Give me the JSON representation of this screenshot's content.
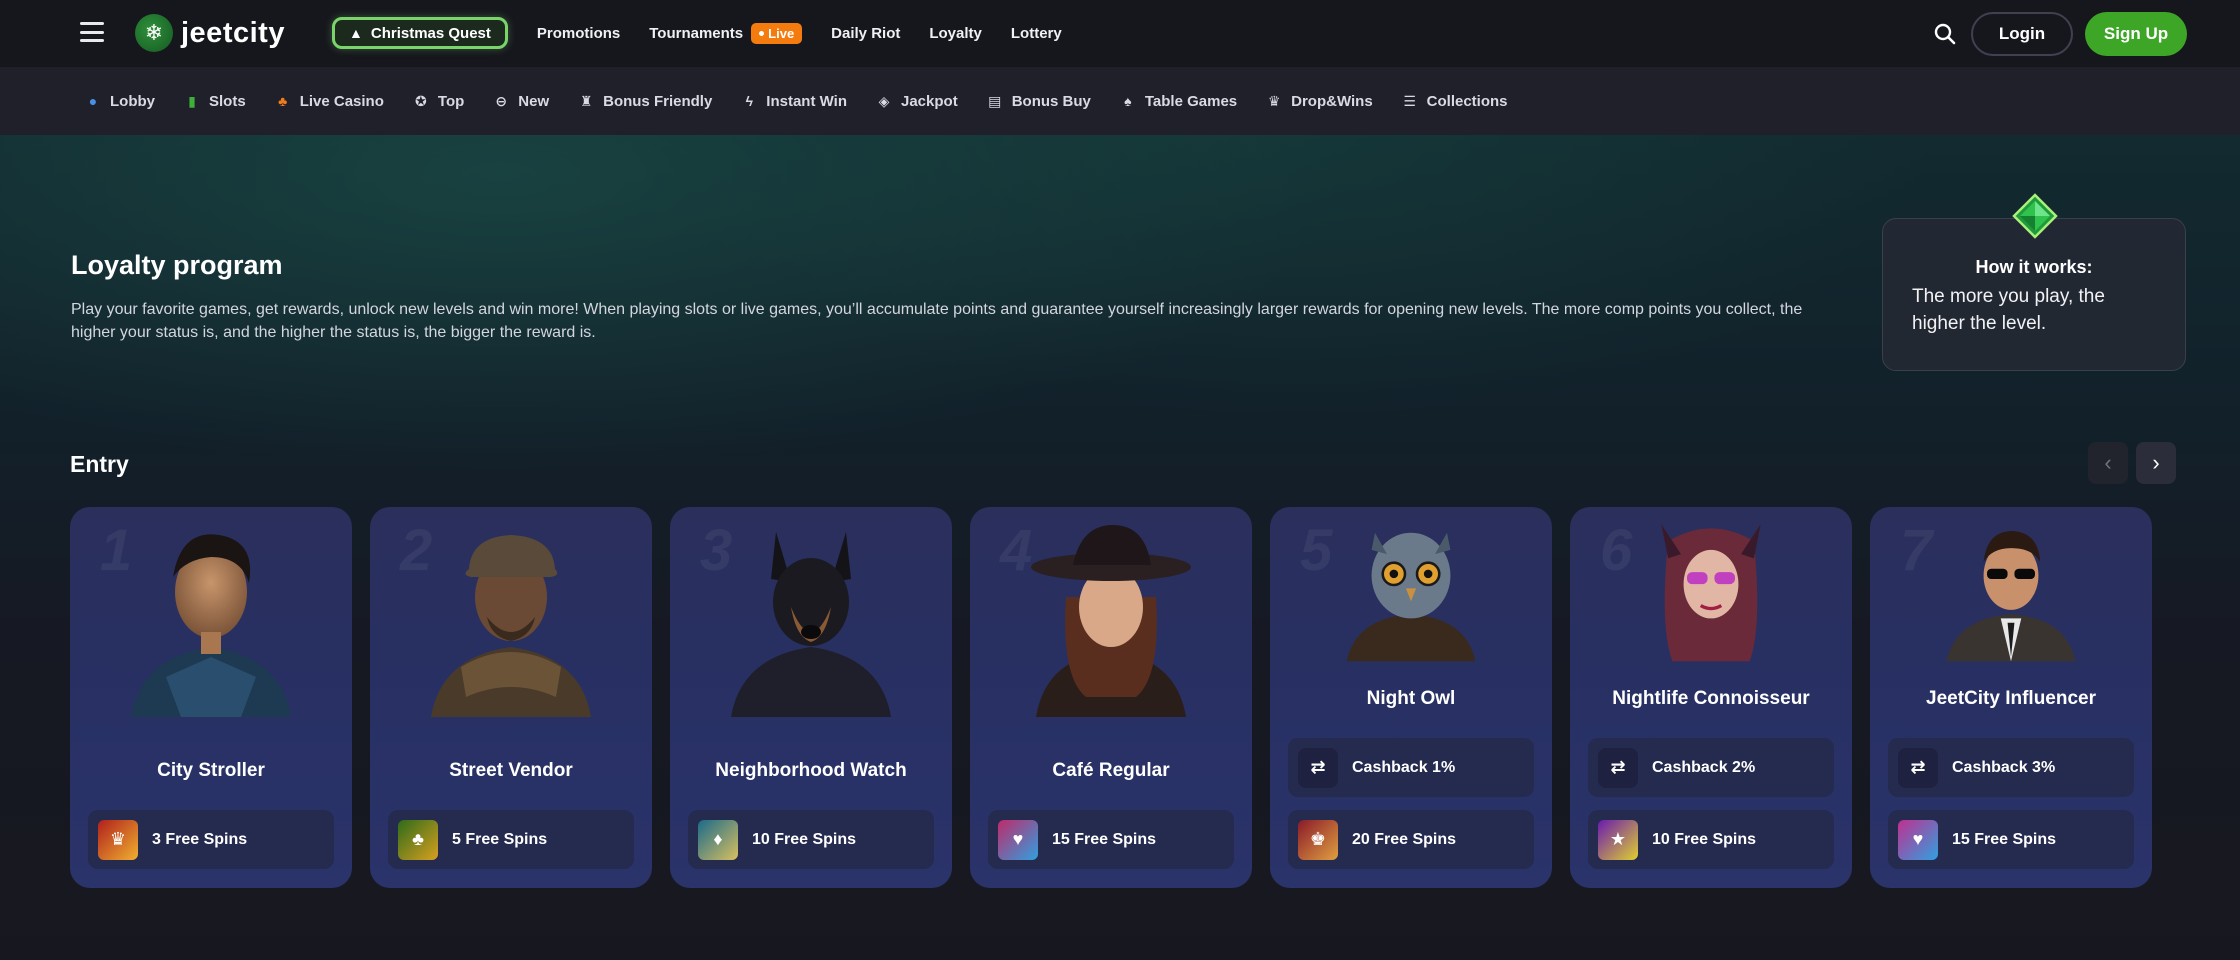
{
  "header": {
    "logo_text": "jeetcity",
    "quest_label": "Christmas Quest",
    "nav": [
      "Promotions",
      "Tournaments",
      "Daily Riot",
      "Loyalty",
      "Lottery"
    ],
    "live_label": "Live",
    "login_label": "Login",
    "signup_label": "Sign Up"
  },
  "categories": [
    {
      "label": "Lobby",
      "icon": "lobby-icon",
      "color": "#4a90e2"
    },
    {
      "label": "Slots",
      "icon": "slots-icon",
      "color": "#3fae3a"
    },
    {
      "label": "Live Casino",
      "icon": "live-casino-icon",
      "color": "#f07c1e"
    },
    {
      "label": "Top",
      "icon": "top-icon",
      "color": "#e0e0e6"
    },
    {
      "label": "New",
      "icon": "new-icon",
      "color": "#e0e0e6"
    },
    {
      "label": "Bonus Friendly",
      "icon": "bonus-friendly-icon",
      "color": "#e0e0e6"
    },
    {
      "label": "Instant Win",
      "icon": "instant-win-icon",
      "color": "#e0e0e6"
    },
    {
      "label": "Jackpot",
      "icon": "jackpot-icon",
      "color": "#e0e0e6"
    },
    {
      "label": "Bonus Buy",
      "icon": "bonus-buy-icon",
      "color": "#e0e0e6"
    },
    {
      "label": "Table Games",
      "icon": "table-games-icon",
      "color": "#e0e0e6"
    },
    {
      "label": "Drop&Wins",
      "icon": "drop-wins-icon",
      "color": "#e0e0e6"
    },
    {
      "label": "Collections",
      "icon": "collections-icon",
      "color": "#e0e0e6"
    }
  ],
  "loyalty": {
    "title": "Loyalty program",
    "description": "Play your favorite games, get rewards, unlock new levels and win more! When playing slots or live games, you’ll accumulate points and guarantee yourself increasingly larger rewards for opening new levels. The more comp points you collect, the higher your status is, and the higher the status is, the bigger the reward is."
  },
  "how_it_works": {
    "title": "How it works:",
    "text": "The more you play, the higher the level."
  },
  "entry": {
    "title": "Entry",
    "levels": [
      {
        "num": "1",
        "name": "City Stroller",
        "cashback": null,
        "spins": "3 Free Spins"
      },
      {
        "num": "2",
        "name": "Street Vendor",
        "cashback": null,
        "spins": "5 Free Spins"
      },
      {
        "num": "3",
        "name": "Neighborhood Watch",
        "cashback": null,
        "spins": "10 Free Spins"
      },
      {
        "num": "4",
        "name": "Café Regular",
        "cashback": null,
        "spins": "15 Free Spins"
      },
      {
        "num": "5",
        "name": "Night Owl",
        "cashback": "Cashback 1%",
        "spins": "20 Free Spins"
      },
      {
        "num": "6",
        "name": "Nightlife Connoisseur",
        "cashback": "Cashback 2%",
        "spins": "10 Free Spins"
      },
      {
        "num": "7",
        "name": "JeetCity Influencer",
        "cashback": "Cashback 3%",
        "spins": "15 Free Spins"
      }
    ]
  },
  "colors": {
    "accent_green": "#3ea626",
    "live_orange": "#f47b0e",
    "card_bg": "#2a3163"
  }
}
